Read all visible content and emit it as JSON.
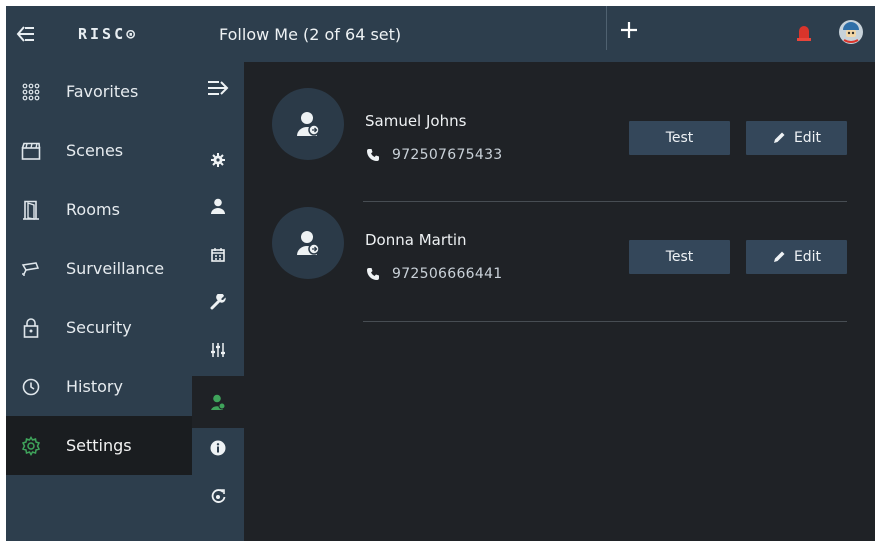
{
  "sidebar": {
    "back_icon": "menu-collapse-icon",
    "logo": "RISC⊙",
    "items": [
      {
        "label": "Favorites",
        "icon": "grid-icon"
      },
      {
        "label": "Scenes",
        "icon": "clapperboard-icon"
      },
      {
        "label": "Rooms",
        "icon": "door-icon"
      },
      {
        "label": "Surveillance",
        "icon": "camera-icon"
      },
      {
        "label": "Security",
        "icon": "lock-icon"
      },
      {
        "label": "History",
        "icon": "clock-icon"
      },
      {
        "label": "Settings",
        "icon": "gear-icon",
        "active": true
      }
    ]
  },
  "subnav": {
    "items": [
      "expand-icon",
      "gear-icon",
      "user-icon",
      "calendar-icon",
      "wrench-icon",
      "sliders-icon",
      "follow-me-icon",
      "info-icon",
      "update-icon"
    ],
    "active": "follow-me-icon"
  },
  "header": {
    "title": "Follow Me (2 of 64 set)"
  },
  "contacts": [
    {
      "name": "Samuel Johns",
      "phone": "972507675433",
      "test_label": "Test",
      "edit_label": "Edit"
    },
    {
      "name": "Donna Martin",
      "phone": "972506666441",
      "test_label": "Test",
      "edit_label": "Edit"
    }
  ],
  "colors": {
    "accent_green": "#3fa45b",
    "panel": "#2d3e4d",
    "background": "#1f2226",
    "button": "#34475a",
    "alarm_red": "#d9342b"
  }
}
